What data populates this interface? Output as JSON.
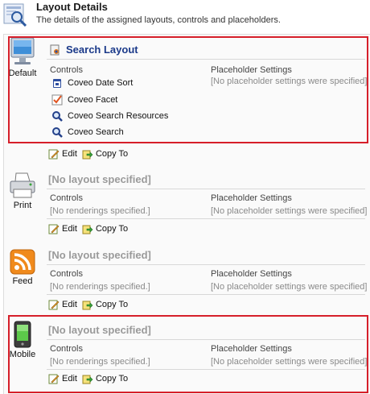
{
  "header": {
    "title": "Layout Details",
    "subtitle": "The details of the assigned layouts, controls and placeholders."
  },
  "labels": {
    "controls": "Controls",
    "placeholder_settings": "Placeholder Settings",
    "edit": "Edit",
    "copy_to": "Copy To"
  },
  "devices": [
    {
      "name": "Default",
      "icon": "monitor-icon",
      "layout": "Search Layout",
      "controls": [
        {
          "label": "Coveo Date Sort",
          "icon": "date-sort-icon"
        },
        {
          "label": "Coveo Facet",
          "icon": "facet-check-icon"
        },
        {
          "label": "Coveo Search Resources",
          "icon": "magnifier-icon"
        },
        {
          "label": "Coveo Search",
          "icon": "magnifier-icon"
        }
      ],
      "placeholder_text": "[No placeholder settings were specified]"
    },
    {
      "name": "Print",
      "icon": "printer-icon",
      "layout": "[No layout specified]",
      "controls_text": "[No renderings specified.]",
      "placeholder_text": "[No placeholder settings were specified]"
    },
    {
      "name": "Feed",
      "icon": "rss-feed-icon",
      "layout": "[No layout specified]",
      "controls_text": "[No renderings specified.]",
      "placeholder_text": "[No placeholder settings were specified]"
    },
    {
      "name": "Mobile",
      "icon": "mobile-phone-icon",
      "layout": "[No layout specified]",
      "controls_text": "[No renderings specified.]",
      "placeholder_text": "[No placeholder settings were specified]"
    }
  ],
  "colors": {
    "highlight": "#d61f2a",
    "layout_title": "#1b3a8a",
    "empty_layout": "#9a9a9a"
  }
}
